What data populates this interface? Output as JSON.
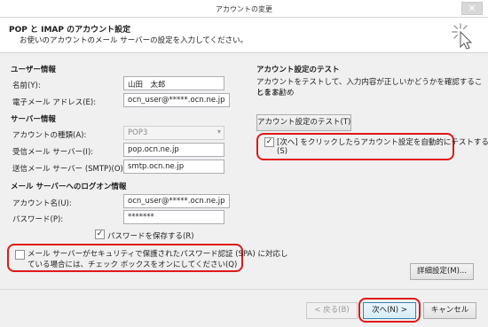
{
  "window": {
    "title": "アカウントの変更",
    "close_glyph": "✕"
  },
  "header": {
    "title": "POP と IMAP のアカウント設定",
    "subtitle": "お使いのアカウントのメール サーバーの設定を入力してください。",
    "icon": "cursor-sparkle-icon"
  },
  "user_info": {
    "section": "ユーザー情報",
    "name_label": "名前(Y):",
    "name_value": "山田　太郎",
    "email_label": "電子メール アドレス(E):",
    "email_value": "ocn_user@*****.ocn.ne.jp"
  },
  "server_info": {
    "section": "サーバー情報",
    "type_label": "アカウントの種類(A):",
    "type_value": "POP3",
    "incoming_label": "受信メール サーバー(I):",
    "incoming_value": "pop.ocn.ne.jp",
    "outgoing_label": "送信メール サーバー (SMTP)(O):",
    "outgoing_value": "smtp.ocn.ne.jp"
  },
  "logon_info": {
    "section": "メール サーバーへのログオン情報",
    "account_label": "アカウント名(U):",
    "account_value": "ocn_user@*****.ocn.ne.jp",
    "password_label": "パスワード(P):",
    "password_value": "*******",
    "save_password_label": "パスワードを保存する(R)",
    "save_password_checked": "✓",
    "spa_line1": "メール サーバーがセキュリティで保護されたパスワード認証 (SPA) に対応し",
    "spa_line2": "ている場合には、チェック ボックスをオンにしてください(Q)"
  },
  "test_settings": {
    "section": "アカウント設定のテスト",
    "description_line1": "アカウントをテストして、入力内容が正しいかどうかを確認することをお勧め",
    "description_line2": "します。",
    "test_button": "アカウント設定のテスト(T)",
    "auto_test_line1": "[次へ] をクリックしたらアカウント設定を自動的にテストする",
    "auto_test_line2": "(S)",
    "auto_test_checked": "✓"
  },
  "buttons": {
    "more_settings": "詳細設定(M)...",
    "back": "< 戻る(B)",
    "next": "次へ(N) >",
    "cancel": "キャンセル"
  },
  "colors": {
    "highlight": "#e01818",
    "background": "#f0f0f0"
  }
}
